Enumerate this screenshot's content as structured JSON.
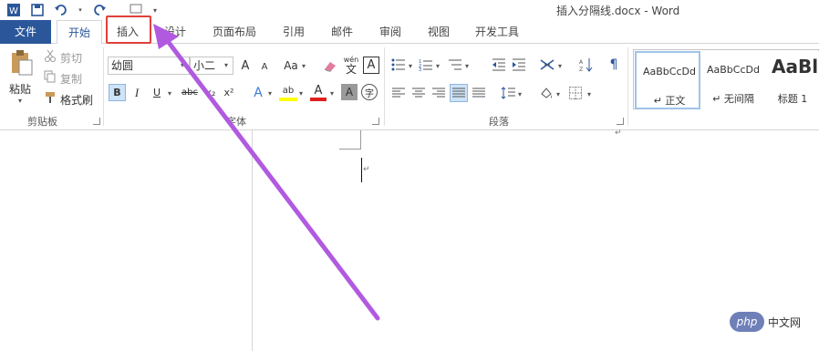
{
  "window": {
    "title": "插入分隔线.docx - Word"
  },
  "tabs": [
    "文件",
    "开始",
    "插入",
    "设计",
    "页面布局",
    "引用",
    "邮件",
    "审阅",
    "视图",
    "开发工具"
  ],
  "clipboard": {
    "paste": "粘贴",
    "cut": "剪切",
    "copy": "复制",
    "format_painter": "格式刷",
    "group_label": "剪贴板"
  },
  "font": {
    "name": "幼圆",
    "size": "小二",
    "group_label": "字体",
    "bold": "B",
    "italic": "I",
    "underline": "U",
    "strike": "abc",
    "subscript": "x₂",
    "superscript": "x²",
    "grow": "A",
    "shrink": "A",
    "case": "Aa",
    "wen": "wén",
    "wen_char": "文",
    "border_char": "A",
    "text_effect": "A",
    "highlight": "ab",
    "font_color": "A",
    "char_shade": "A",
    "enclose": "字"
  },
  "paragraph": {
    "group_label": "段落"
  },
  "styles": [
    {
      "sample": "AaBbCcDd",
      "name": "↵ 正文"
    },
    {
      "sample": "AaBbCcDd",
      "name": "↵ 无间隔"
    },
    {
      "sample": "AaBl",
      "name": "标题 1"
    }
  ],
  "watermark": {
    "logo": "php",
    "text": "中文网"
  },
  "colors": {
    "file_tab": "#2b579a",
    "accent": "#2b579a",
    "highlight_box": "#e0403a",
    "arrow": "#b15ae0"
  }
}
